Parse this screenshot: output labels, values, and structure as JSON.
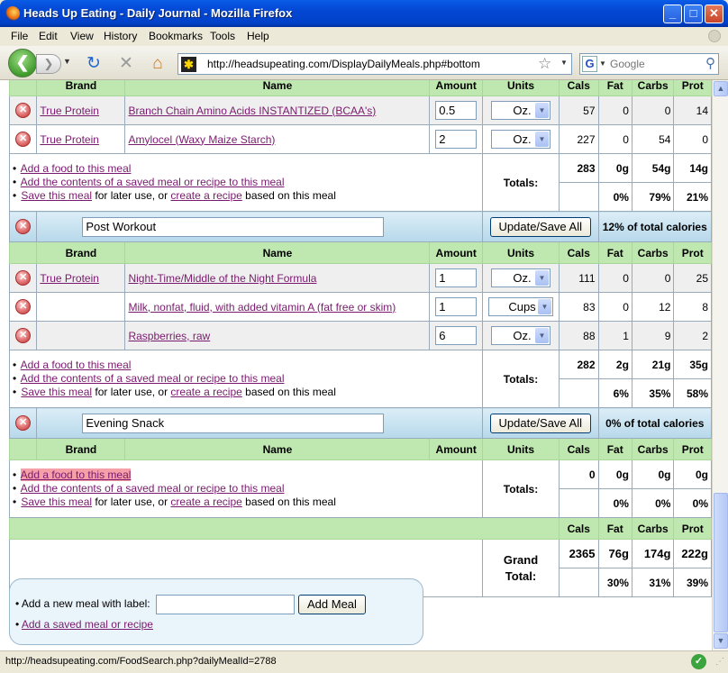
{
  "window": {
    "title": "Heads Up Eating - Daily Journal - Mozilla Firefox",
    "min_glyph": "_",
    "max_glyph": "□",
    "close_glyph": "✕"
  },
  "menu": [
    "File",
    "Edit",
    "View",
    "History",
    "Bookmarks",
    "Tools",
    "Help"
  ],
  "toolbar": {
    "url": "http://headsupeating.com/DisplayDailyMeals.php#bottom",
    "search_placeholder": "Google",
    "search_engine_glyph": "G",
    "site_icon_glyph": "✱",
    "back_glyph": "❮",
    "forward_glyph": "❯",
    "reload_glyph": "↻",
    "stop_glyph": "✕",
    "home_glyph": "⌂",
    "star_glyph": "☆",
    "search_glyph": "⚲",
    "drop_glyph": "▼"
  },
  "columns": {
    "brand": "Brand",
    "name": "Name",
    "amount": "Amount",
    "units": "Units",
    "cals": "Cals",
    "fat": "Fat",
    "carbs": "Carbs",
    "prot": "Prot"
  },
  "labels": {
    "add_food": "Add a food to this meal",
    "add_saved": "Add the contents of a saved meal or recipe to this meal",
    "save_meal": "Save this meal",
    "for_later": " for later use, or ",
    "create_recipe": "create a recipe",
    "based_on": " based on this meal",
    "totals": "Totals:",
    "update_save": "Update/Save All",
    "delete_glyph": "✕",
    "arrow_glyph": "▼",
    "bullet": "•"
  },
  "meal1": {
    "foods": [
      {
        "brand": "True Protein",
        "name": "Branch Chain Amino Acids INSTANTIZED (BCAA's)",
        "amount": "0.5",
        "unit": "Oz.",
        "cals": "57",
        "fat": "0",
        "carbs": "0",
        "prot": "14"
      },
      {
        "brand": "True Protein",
        "name": "Amylocel (Waxy Maize Starch)",
        "amount": "2",
        "unit": "Oz.",
        "cals": "227",
        "fat": "0",
        "carbs": "54",
        "prot": "0"
      }
    ],
    "totals": {
      "cals": "283",
      "fat": "0g",
      "carbs": "54g",
      "prot": "14g"
    },
    "pct": {
      "fat": "0%",
      "carbs": "79%",
      "prot": "21%"
    }
  },
  "meal2": {
    "name": "Post Workout",
    "pct_total": "12% of total calories",
    "foods": [
      {
        "brand": "True Protein",
        "name": "Night-Time/Middle of the Night Formula",
        "amount": "1",
        "unit": "Oz.",
        "cals": "111",
        "fat": "0",
        "carbs": "0",
        "prot": "25"
      },
      {
        "brand": "",
        "name": "Milk, nonfat, fluid, with added vitamin A (fat free or skim)",
        "amount": "1",
        "unit": "Cups",
        "cals": "83",
        "fat": "0",
        "carbs": "12",
        "prot": "8"
      },
      {
        "brand": "",
        "name": "Raspberries, raw",
        "amount": "6",
        "unit": "Oz.",
        "cals": "88",
        "fat": "1",
        "carbs": "9",
        "prot": "2"
      }
    ],
    "totals": {
      "cals": "282",
      "fat": "2g",
      "carbs": "21g",
      "prot": "35g"
    },
    "pct": {
      "fat": "6%",
      "carbs": "35%",
      "prot": "58%"
    }
  },
  "meal3": {
    "name": "Evening Snack",
    "pct_total": "0% of total calories",
    "totals": {
      "cals": "0",
      "fat": "0g",
      "carbs": "0g",
      "prot": "0g"
    },
    "pct": {
      "fat": "0%",
      "carbs": "0%",
      "prot": "0%"
    }
  },
  "grand": {
    "label_line1": "Grand",
    "label_line2": "Total:",
    "cals": "2365",
    "fat": "76g",
    "carbs": "174g",
    "prot": "222g",
    "pct": {
      "fat": "30%",
      "carbs": "31%",
      "prot": "39%"
    }
  },
  "add_meal": {
    "label": "Add a new meal with label:",
    "button": "Add Meal",
    "saved_link": "Add a saved meal or recipe"
  },
  "status": {
    "text": "http://headsupeating.com/FoodSearch.php?dailyMealId=2788",
    "ok_glyph": "✓",
    "grip_glyph": "⋰"
  }
}
